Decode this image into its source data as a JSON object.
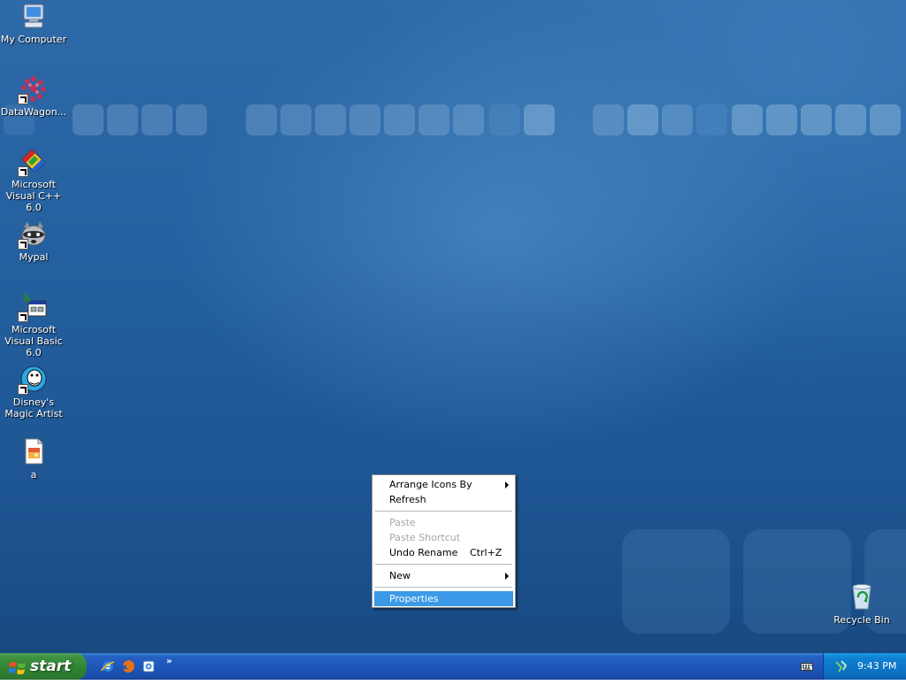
{
  "desktop": {
    "icons": [
      {
        "label": "My Computer",
        "icon": "my-computer-icon",
        "shortcut": false
      },
      {
        "label": "DataWagon...",
        "icon": "datawagon-icon",
        "shortcut": true
      },
      {
        "label": "Microsoft Visual C++ 6.0",
        "icon": "visual-cpp-icon",
        "shortcut": true
      },
      {
        "label": "Mypal",
        "icon": "mypal-raccoon-icon",
        "shortcut": true
      },
      {
        "label": "Microsoft Visual Basic 6.0",
        "icon": "visual-basic-icon",
        "shortcut": true
      },
      {
        "label": "Disney's Magic Artist",
        "icon": "magic-artist-icon",
        "shortcut": true
      },
      {
        "label": "a",
        "icon": "image-file-icon",
        "shortcut": false
      }
    ],
    "recycle_bin": {
      "label": "Recycle Bin",
      "icon": "recycle-bin-icon"
    }
  },
  "context_menu": {
    "items": [
      {
        "label": "Arrange Icons By",
        "submenu": true,
        "enabled": true
      },
      {
        "label": "Refresh",
        "enabled": true
      },
      {
        "separator": true
      },
      {
        "label": "Paste",
        "enabled": false
      },
      {
        "label": "Paste Shortcut",
        "enabled": false
      },
      {
        "label": "Undo Rename",
        "shortcut": "Ctrl+Z",
        "enabled": true
      },
      {
        "separator": true
      },
      {
        "label": "New",
        "submenu": true,
        "enabled": true
      },
      {
        "separator": true
      },
      {
        "label": "Properties",
        "enabled": true,
        "highlighted": true
      }
    ]
  },
  "taskbar": {
    "start_label": "start",
    "quick_launch": [
      "internet-explorer-icon",
      "firefox-icon",
      "quick-launch-app-icon"
    ],
    "quick_launch_more": "»",
    "clock": "9:43 PM",
    "colors": {
      "taskbar": "#245edb",
      "start": "#3c8d3c",
      "tray": "#0f81d0",
      "highlight": "#3b99e8"
    }
  }
}
